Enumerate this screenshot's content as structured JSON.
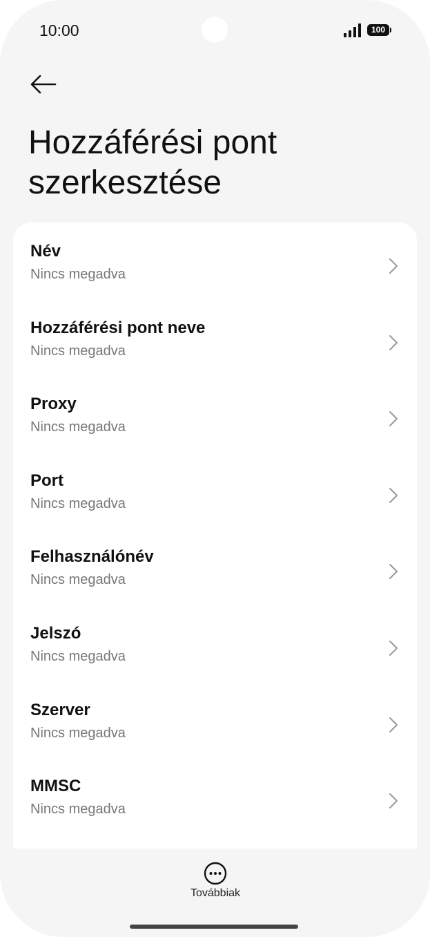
{
  "status_bar": {
    "time": "10:00",
    "battery": "100",
    "icons": [
      "signal-icon",
      "battery-icon"
    ]
  },
  "header": {
    "back_icon": "arrow-left-icon",
    "title": "Hozzáférési pont szerkesztése"
  },
  "list": {
    "chevron_icon": "chevron-right-icon",
    "items": [
      {
        "title": "Név",
        "value": "Nincs megadva"
      },
      {
        "title": "Hozzáférési pont neve",
        "value": "Nincs megadva"
      },
      {
        "title": "Proxy",
        "value": "Nincs megadva"
      },
      {
        "title": "Port",
        "value": "Nincs megadva"
      },
      {
        "title": "Felhasználónév",
        "value": "Nincs megadva"
      },
      {
        "title": "Jelszó",
        "value": "Nincs megadva"
      },
      {
        "title": "Szerver",
        "value": "Nincs megadva"
      },
      {
        "title": "MMSC",
        "value": "Nincs megadva"
      }
    ]
  },
  "bottom_bar": {
    "more_label": "Továbbiak",
    "more_icon": "more-dots-icon"
  },
  "colors": {
    "background": "#f5f5f5",
    "card": "#ffffff",
    "text_primary": "#111111",
    "text_secondary": "#777777"
  }
}
